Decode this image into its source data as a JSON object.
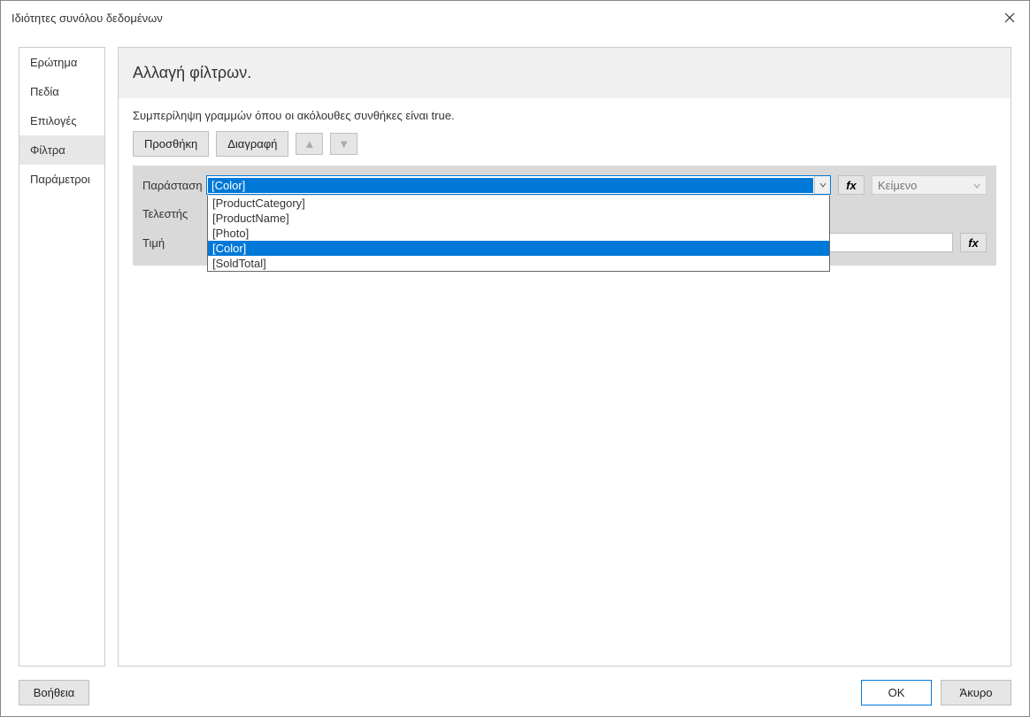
{
  "titlebar": {
    "title": "Ιδιότητες συνόλου δεδομένων"
  },
  "sidebar": {
    "items": [
      {
        "label": "Ερώτημα"
      },
      {
        "label": "Πεδία"
      },
      {
        "label": "Επιλογές"
      },
      {
        "label": "Φίλτρα"
      },
      {
        "label": "Παράμετροι"
      }
    ]
  },
  "main": {
    "heading": "Αλλαγή φίλτρων.",
    "subheading": "Συμπερίληψη γραμμών όπου οι ακόλουθες συνθήκες είναι true.",
    "toolbar": {
      "add": "Προσθήκη",
      "delete": "Διαγραφή"
    },
    "filter": {
      "expression_label": "Παράσταση",
      "expression_value": "[Color]",
      "operator_label": "Τελεστής",
      "value_label": "Τιμή",
      "type_value": "Κείμενο",
      "fx": "fx",
      "options": [
        "[ProductCategory]",
        "[ProductName]",
        "[Photo]",
        "[Color]",
        "[SoldTotal]"
      ]
    }
  },
  "footer": {
    "help": "Βοήθεια",
    "ok": "OK",
    "cancel": "Άκυρο"
  }
}
